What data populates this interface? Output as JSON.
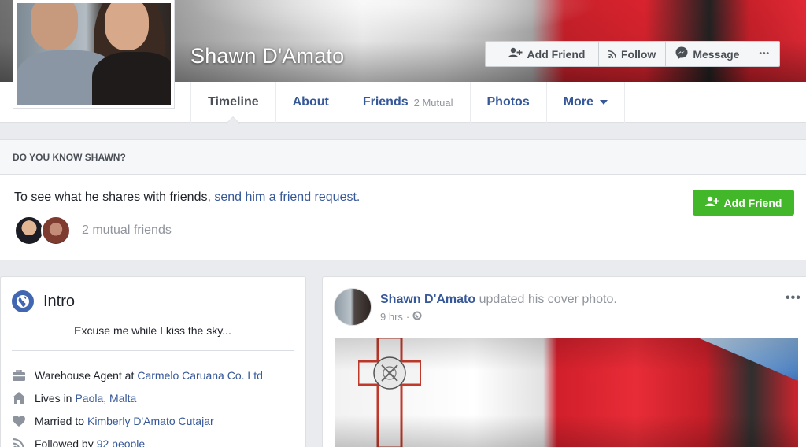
{
  "profile": {
    "name": "Shawn D'Amato"
  },
  "cover_actions": {
    "add_friend": "Add Friend",
    "follow": "Follow",
    "message": "Message",
    "more": "•••"
  },
  "tabs": [
    {
      "label": "Timeline",
      "active": true
    },
    {
      "label": "About"
    },
    {
      "label": "Friends",
      "sub": "2 Mutual"
    },
    {
      "label": "Photos"
    },
    {
      "label": "More"
    }
  ],
  "know_panel": {
    "heading": "DO YOU KNOW SHAWN?",
    "prompt": "To see what he shares with friends,",
    "prompt_link": "send him a friend request.",
    "mutual_text": "2 mutual friends",
    "add_friend": "Add Friend"
  },
  "intro": {
    "title": "Intro",
    "bio": "Excuse me while I kiss the sky...",
    "facts": [
      {
        "icon": "briefcase-icon",
        "prefix": "Warehouse Agent at",
        "link": "Carmelo Caruana Co. Ltd"
      },
      {
        "icon": "home-icon",
        "prefix": "Lives in",
        "link": "Paola, Malta"
      },
      {
        "icon": "heart-icon",
        "prefix": "Married to",
        "link": "Kimberly D'Amato Cutajar"
      },
      {
        "icon": "rss-icon",
        "prefix": "Followed by",
        "link": "92 people"
      }
    ]
  },
  "post": {
    "author": "Shawn D'Amato",
    "action": "updated his cover photo.",
    "time": "9 hrs",
    "separator": "·",
    "menu": "•••"
  },
  "colors": {
    "link": "#365899",
    "green": "#42b72a",
    "page_bg": "#e9ebee"
  }
}
